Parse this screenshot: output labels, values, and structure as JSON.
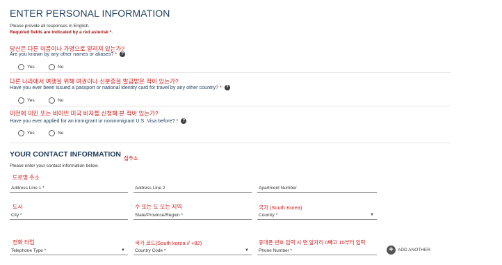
{
  "personal": {
    "title": "ENTER PERSONAL INFORMATION",
    "instruction": "Please provide all responses in English.",
    "required_note": "Required fields are indicated by a red asterisk *."
  },
  "questions": [
    {
      "korean": "당신은 다른 이름이나 가명으로 알려져 있는가?",
      "text": "Are you known by any other names or aliases?",
      "yes": "Yes",
      "no": "No"
    },
    {
      "korean": "다른 나라에서 여행을 위해 여권이나 신분증을 발급받은 적이 있는가?",
      "text": "Have you ever been issued a passport or national identity card for travel by any other country?",
      "yes": "Yes",
      "no": "No"
    },
    {
      "korean": "이전에 이민 또는 비이민 미국 비자를 신청해 본 적이 있는가?",
      "text": "Have you ever applied for an immigrant or nonimmigrant U.S. Visa before?",
      "yes": "Yes",
      "no": "No"
    }
  ],
  "required_mark": "*",
  "help_glyph": "?",
  "contact": {
    "title": "YOUR CONTACT INFORMATION",
    "title_korean": "집주소",
    "instruction": "Please enter your contact information below."
  },
  "address": {
    "line1_korean": "도로명 주소",
    "line1_label": "Address Line 1 *",
    "line2_label": "Address Line 2",
    "apt_label": "Apartment Number"
  },
  "location": {
    "city_korean": "도시",
    "city_label": "City *",
    "state_korean": "수 또는 도 또는 지역",
    "state_label": "State/Province/Region *",
    "country_korean": "국가 (South Korea)",
    "country_label": "Country *"
  },
  "phone": {
    "type_korean": "전화 타입",
    "type_label": "Telephone Type *",
    "code_korean": "국가 코드(South korea // +82)",
    "code_label": "Country Code *",
    "number_korean": "휴대폰 번호 입력 시 맨 앞자리 0빼고 10부터 입력",
    "number_label": "Phone Number *",
    "add_another": "ADD ANOTHER",
    "plus_glyph": "+"
  },
  "colors": {
    "heading": "#1f3c5a",
    "korean_note": "#d01a1a",
    "required": "#a31515"
  },
  "icons": [
    "question-circle-icon",
    "chevron-down-icon",
    "plus-circle-icon"
  ]
}
